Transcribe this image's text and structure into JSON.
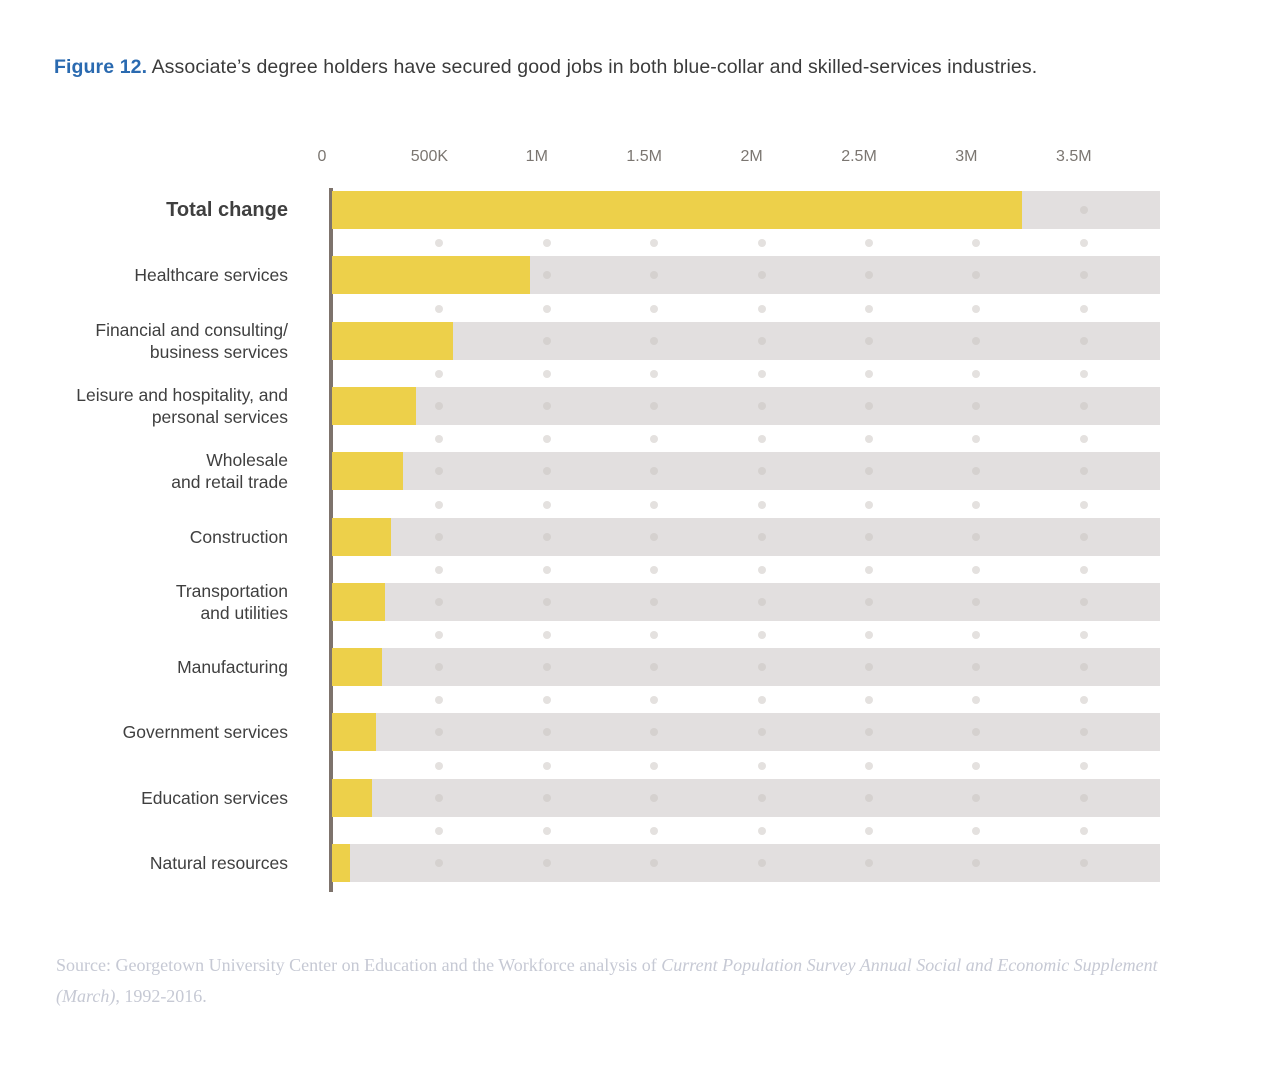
{
  "figure": {
    "number_label": "Figure 12.",
    "title": "Associate’s degree holders have secured good jobs in both blue-collar and skilled-services industries.",
    "number_color": "#2a6ab0",
    "title_color": "#3b3b3b"
  },
  "colors": {
    "bar": "#edd04a",
    "track": "#e2dfdf",
    "axis_line": "#7d736c",
    "dot": "#d5d1cf",
    "tick_text": "#7b7671",
    "label_text": "#3f3f3f",
    "source_text": "#c6c9d4"
  },
  "source": {
    "prefix": "Source: Georgetown University Center on Education and the Workforce analysis of ",
    "italic": "Current Population Survey Annual Social and Economic Supplement (March)",
    "suffix": ", 1992-2016."
  },
  "chart_data": {
    "type": "bar",
    "orientation": "horizontal",
    "title": "Associate’s degree holders have secured good jobs in both blue-collar and skilled-services industries.",
    "xlabel": "",
    "ylabel": "",
    "xlim": [
      0,
      3860000
    ],
    "grid": "dotted",
    "legend": "none",
    "tick_labels": [
      "0",
      "500K",
      "1M",
      "1.5M",
      "2M",
      "2.5M",
      "3M",
      "3.5M"
    ],
    "tick_values": [
      0,
      500000,
      1000000,
      1500000,
      2000000,
      2500000,
      3000000,
      3500000
    ],
    "categories": [
      "Total change",
      "Healthcare services",
      "Financial and consulting/\nbusiness services",
      "Leisure and hospitality, and\npersonal services",
      "Wholesale\nand retail trade",
      "Construction",
      "Transportation\nand utilities",
      "Manufacturing",
      "Government services",
      "Education services",
      "Natural resources"
    ],
    "values": [
      3210000,
      920000,
      565000,
      390000,
      330000,
      275000,
      248000,
      233000,
      205000,
      187000,
      85000
    ]
  }
}
